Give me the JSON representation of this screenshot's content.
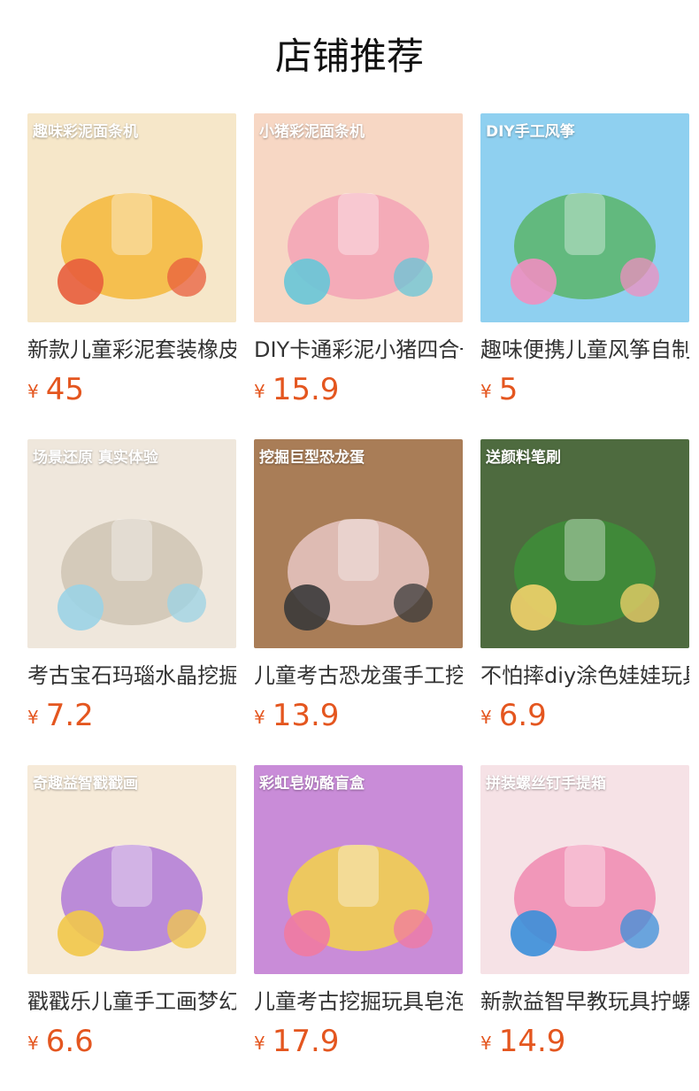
{
  "page": {
    "title": "店铺推荐"
  },
  "currency": "¥",
  "products": [
    {
      "name": "新款儿童彩泥套装橡皮泥",
      "price": "45",
      "banner": "趣味彩泥面条机",
      "colors": [
        "#f6e7c9",
        "#f4b73a",
        "#e85d3c"
      ]
    },
    {
      "name": "DIY卡通彩泥小猪四合一",
      "price": "15.9",
      "banner": "小猪彩泥面条机",
      "colors": [
        "#f7d7c4",
        "#f3a3b6",
        "#67c6d8"
      ]
    },
    {
      "name": "趣味便携儿童风筝自制",
      "price": "5",
      "banner": "DIY手工风筝",
      "colors": [
        "#8fd0f0",
        "#5ab56a",
        "#f08fc0"
      ]
    },
    {
      "name": "考古宝石玛瑙水晶挖掘",
      "price": "7.2",
      "banner": "场景还原 真实体验",
      "colors": [
        "#efe7dc",
        "#cfc4b4",
        "#9bd3e6"
      ]
    },
    {
      "name": "儿童考古恐龙蛋手工挖掘",
      "price": "13.9",
      "banner": "挖掘巨型恐龙蛋",
      "colors": [
        "#a97d57",
        "#e8c6c3",
        "#3a3a3a"
      ]
    },
    {
      "name": "不怕摔diy涂色娃娃玩具",
      "price": "6.9",
      "banner": "送颜料笔刷",
      "colors": [
        "#4e6b3f",
        "#3e8e38",
        "#f2d36b"
      ]
    },
    {
      "name": "戳戳乐儿童手工画梦幻",
      "price": "6.6",
      "banner": "奇趣益智戳戳画",
      "colors": [
        "#f6ead8",
        "#b07ad8",
        "#f2c84a"
      ]
    },
    {
      "name": "儿童考古挖掘玩具皂泡",
      "price": "17.9",
      "banner": "彩虹皂奶酪盲盒",
      "colors": [
        "#c98cd8",
        "#f3d24a",
        "#f07aa2"
      ]
    },
    {
      "name": "新款益智早教玩具拧螺丝",
      "price": "14.9",
      "banner": "拼装螺丝钉手提箱",
      "colors": [
        "#f6e2e6",
        "#f08ab0",
        "#3b8fd9"
      ]
    }
  ]
}
